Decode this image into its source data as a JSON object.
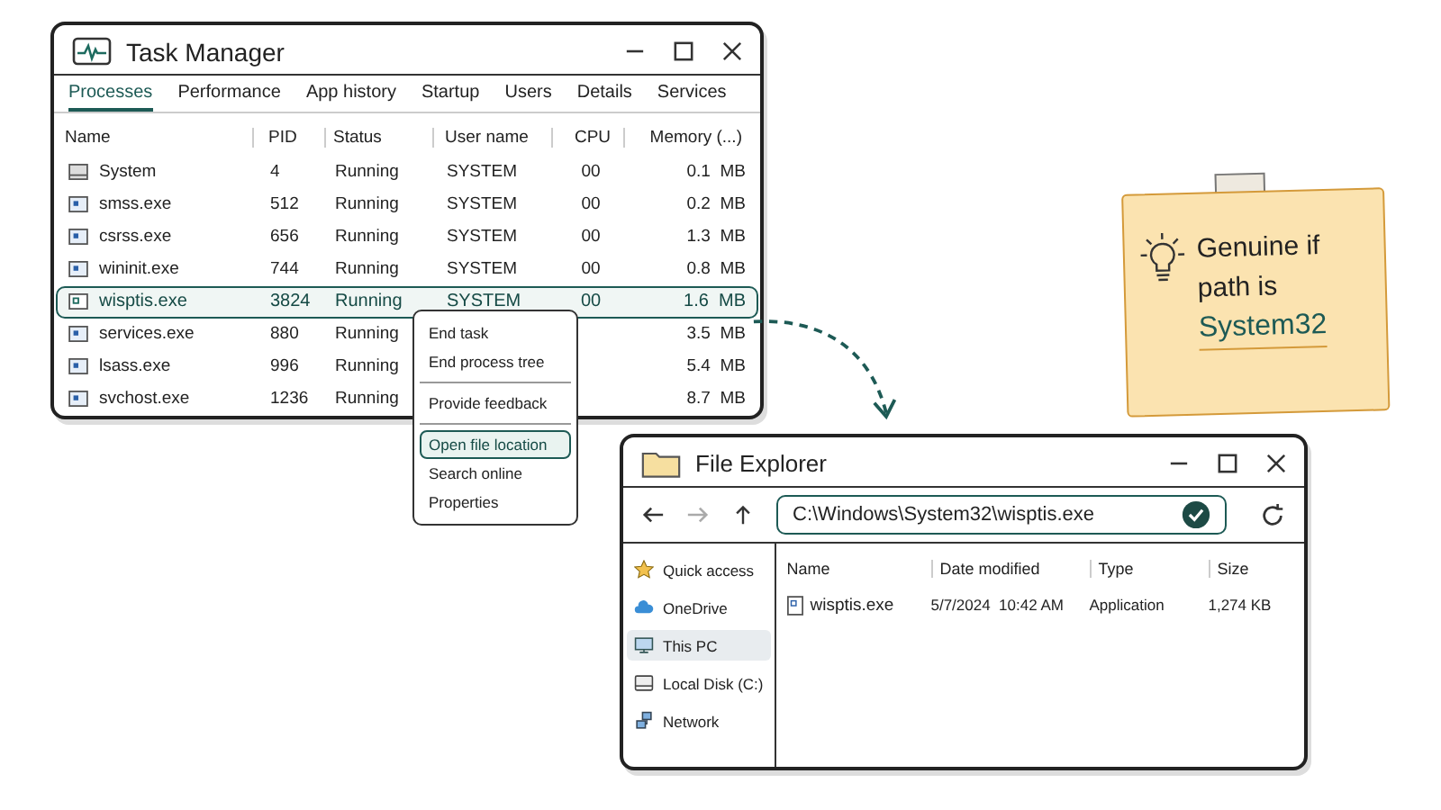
{
  "task_manager": {
    "title": "Task Manager",
    "tabs": [
      {
        "label": "Processes",
        "selected": true
      },
      {
        "label": "Performance",
        "selected": false
      },
      {
        "label": "App history",
        "selected": false
      },
      {
        "label": "Startup",
        "selected": false
      },
      {
        "label": "Users",
        "selected": false
      },
      {
        "label": "Details",
        "selected": false
      },
      {
        "label": "Services",
        "selected": false
      }
    ],
    "columns": [
      "Name",
      "PID",
      "Status",
      "User name",
      "CPU",
      "Memory (...)"
    ],
    "rows": [
      {
        "kind": "system",
        "name": "System",
        "pid": "4",
        "status": "Running",
        "user": "SYSTEM",
        "cpu": "00",
        "memory": "0.1  MB",
        "selected": false
      },
      {
        "kind": "exe",
        "name": "smss.exe",
        "pid": "512",
        "status": "Running",
        "user": "SYSTEM",
        "cpu": "00",
        "memory": "0.2  MB",
        "selected": false
      },
      {
        "kind": "exe",
        "name": "csrss.exe",
        "pid": "656",
        "status": "Running",
        "user": "SYSTEM",
        "cpu": "00",
        "memory": "1.3  MB",
        "selected": false
      },
      {
        "kind": "exe",
        "name": "wininit.exe",
        "pid": "744",
        "status": "Running",
        "user": "SYSTEM",
        "cpu": "00",
        "memory": "0.8  MB",
        "selected": false
      },
      {
        "kind": "exe",
        "name": "wisptis.exe",
        "pid": "3824",
        "status": "Running",
        "user": "SYSTEM",
        "cpu": "00",
        "memory": "1.6  MB",
        "selected": true
      },
      {
        "kind": "exe",
        "name": "services.exe",
        "pid": "880",
        "status": "Running",
        "memory": "3.5  MB",
        "selected": false
      },
      {
        "kind": "exe",
        "name": "lsass.exe",
        "pid": "996",
        "status": "Running",
        "memory": "5.4  MB",
        "selected": false
      },
      {
        "kind": "exe",
        "name": "svchost.exe",
        "pid": "1236",
        "status": "Running",
        "memory": "8.7  MB",
        "selected": false
      }
    ]
  },
  "context_menu": {
    "groups": [
      [
        {
          "label": "End task",
          "selected": false
        },
        {
          "label": "End process tree",
          "selected": false
        }
      ],
      [
        {
          "label": "Provide feedback",
          "selected": false
        }
      ],
      [
        {
          "label": "Open file location",
          "selected": true
        },
        {
          "label": "Search online",
          "selected": false
        },
        {
          "label": "Properties",
          "selected": false
        }
      ]
    ]
  },
  "note": {
    "text": "Genuine if path is",
    "highlight": "System32"
  },
  "file_explorer": {
    "title": "File Explorer",
    "address": "C:\\Windows\\System32\\wisptis.exe",
    "verified": true,
    "sidebar": [
      {
        "kind": "star",
        "label": "Quick access",
        "selected": false
      },
      {
        "kind": "cloud",
        "label": "OneDrive",
        "selected": false
      },
      {
        "kind": "pc",
        "label": "This PC",
        "selected": true
      },
      {
        "kind": "disk",
        "label": "Local Disk (C:)",
        "selected": false
      },
      {
        "kind": "network",
        "label": "Network",
        "selected": false
      }
    ],
    "columns": [
      "Name",
      "Date modified",
      "Type",
      "Size"
    ],
    "files": [
      {
        "name": "wisptis.exe",
        "date": "5/7/2024  10:42 AM",
        "type": "Application",
        "size": "1,274 KB"
      }
    ]
  }
}
